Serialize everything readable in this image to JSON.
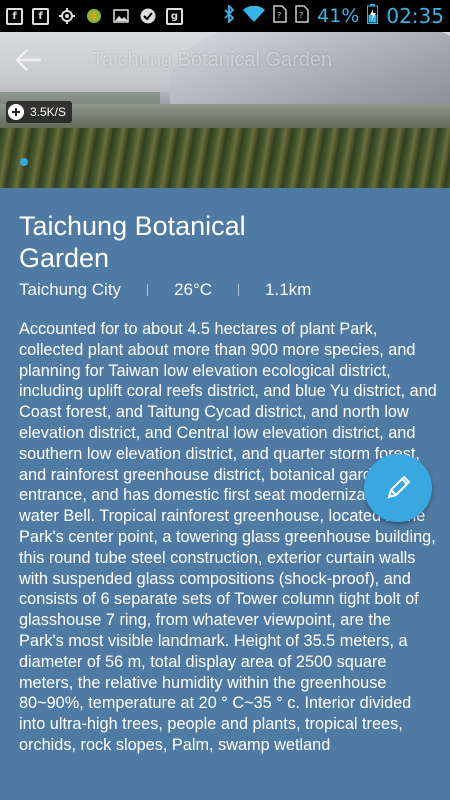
{
  "status_bar": {
    "battery_percent": "41%",
    "time": "02:35",
    "icons": [
      "facebook-icon",
      "facebook-icon",
      "gps-icon",
      "app-icon",
      "image-icon",
      "check-icon",
      "google-plus-icon",
      "bluetooth-icon",
      "wifi-icon",
      "no-sim-icon",
      "no-sim-icon",
      "battery-icon"
    ]
  },
  "toolbar": {
    "title": "Taichung Botanical Garden"
  },
  "overlay": {
    "speed": "3.5K/S"
  },
  "place": {
    "title": "Taichung Botanical Garden",
    "city": "Taichung City",
    "temperature": "26°C",
    "distance": "1.1km",
    "description": "Accounted for to about 4.5 hectares of plant Park, collected plant about more than 900 more species, and planning for Taiwan low elevation ecological district, including uplift coral reefs district, and blue Yu district, and Coast forest, and Taitung Cycad district, and north low elevation district, and Central low elevation district, and southern low elevation district, and quarter storm forest, and rainforest greenhouse district, botanical gardens entrance, and has domestic first seat modernization of water Bell. Tropical rainforest greenhouse, located in the Park's center point, a towering glass greenhouse building, this round tube steel construction, exterior curtain walls with suspended glass compositions (shock-proof), and consists of 6 separate sets of Tower column tight bolt of glasshouse 7 ring, from whatever viewpoint, are the Park's most visible landmark. Height of 35.5 meters, a diameter of 56 m, total display area of 2500 square meters, the relative humidity within the greenhouse 80~90%, temperature at 20 ° C~35 ° c. Interior divided into ultra-high trees, people and plants, tropical trees, orchids, rock slopes, Palm, swamp wetland"
  },
  "colors": {
    "background": "#4f7aa3",
    "accent": "#39a8e0",
    "status_text": "#39b4e6"
  }
}
